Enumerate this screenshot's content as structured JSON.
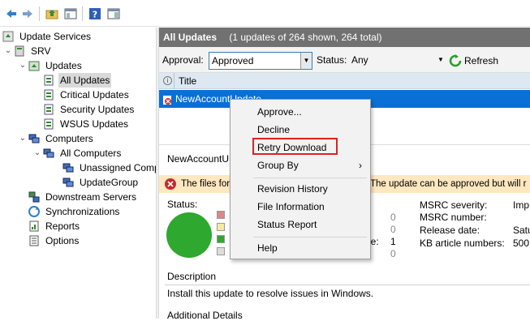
{
  "toolbar": {
    "buttons": [
      "back-icon",
      "forward-icon",
      "folder-up-icon",
      "show-hide-tree-icon",
      "help-icon",
      "action-pane-icon"
    ]
  },
  "tree": {
    "root": "Update Services",
    "server": "SRV",
    "updates": "Updates",
    "all_updates": "All Updates",
    "critical_updates": "Critical Updates",
    "security_updates": "Security Updates",
    "wsus_updates": "WSUS Updates",
    "computers": "Computers",
    "all_computers": "All Computers",
    "unassigned": "Unassigned Comp",
    "update_group": "UpdateGroup",
    "downstream": "Downstream Servers",
    "synchronizations": "Synchronizations",
    "reports": "Reports",
    "options": "Options"
  },
  "header": {
    "title": "All Updates",
    "summary": "(1 updates of 264 shown, 264 total)"
  },
  "filter": {
    "approval_label": "Approval:",
    "approval_value": "Approved",
    "status_label": "Status:",
    "status_value": "Any",
    "refresh_label": "Refresh"
  },
  "list": {
    "info_col": "i",
    "title_col": "Title",
    "row_title": "NewAccountUpdate"
  },
  "detail": {
    "update_name": "NewAccountU",
    "warning_left": "The files for",
    "warning_right": "The update can be approved but will r",
    "status_label": "Status:",
    "counts": [
      "0",
      "0",
      "1",
      "0"
    ],
    "count_partial_label": "le:",
    "msrc_severity_label": "MSRC severity:",
    "msrc_severity_value": "Imp",
    "msrc_number_label": "MSRC number:",
    "release_date_label": "Release date:",
    "release_date_value": "Satu",
    "kb_label": "KB article numbers:",
    "kb_value": "500",
    "description_heading": "Description",
    "description_text": "Install this update to resolve issues in Windows.",
    "additional_heading": "Additional Details"
  },
  "context_menu": {
    "approve": "Approve...",
    "decline": "Decline",
    "retry": "Retry Download",
    "group_by": "Group By",
    "revision": "Revision History",
    "file_info": "File Information",
    "status_report": "Status Report",
    "help": "Help"
  },
  "colors": {
    "selection": "#0a6fd6",
    "header_bg": "#717171",
    "highlight_box": "#e02020",
    "status_green": "#2ea82e",
    "warning_bg": "#ffe7bf"
  }
}
